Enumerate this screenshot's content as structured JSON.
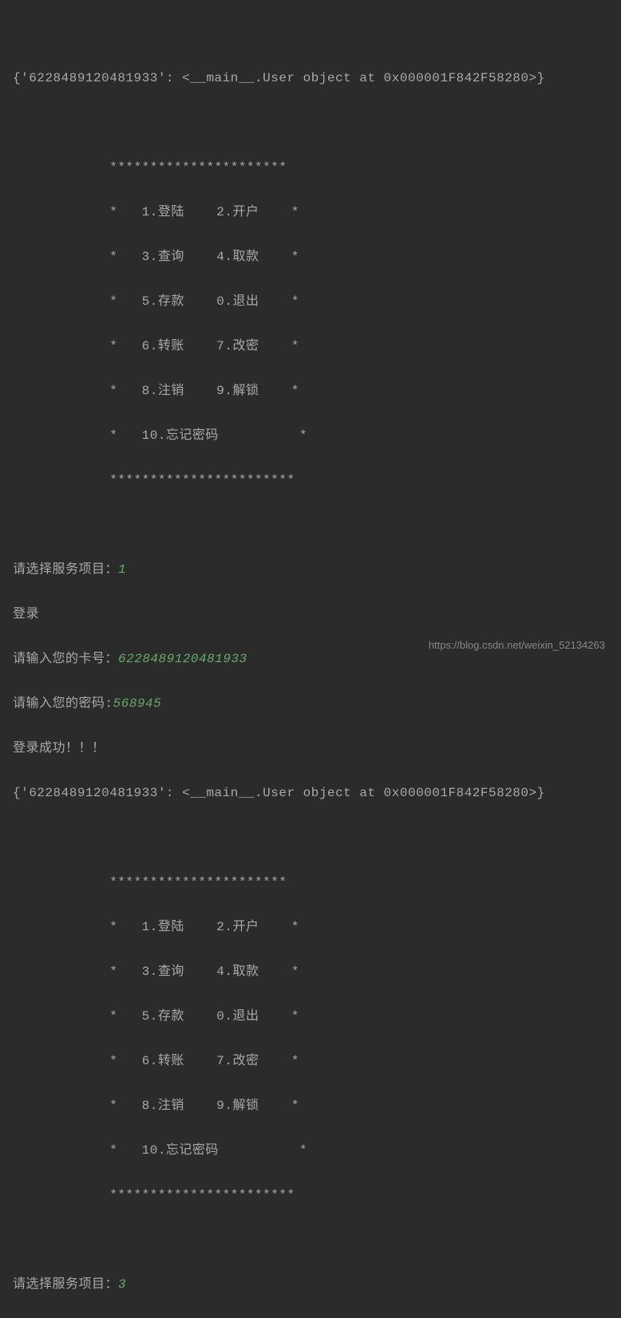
{
  "lines": [
    {
      "indent": "            ",
      "text": ""
    },
    {
      "indent": "",
      "text": "{'6228489120481933': <__main__.User object at 0x000001F842F58280>}"
    },
    {
      "indent": "",
      "text": ""
    },
    {
      "indent": "            ",
      "text": "**********************"
    },
    {
      "indent": "            ",
      "text": "*   1.登陆    2.开户    *"
    },
    {
      "indent": "            ",
      "text": "*   3.查询    4.取款    *"
    },
    {
      "indent": "            ",
      "text": "*   5.存款    0.退出    *"
    },
    {
      "indent": "            ",
      "text": "*   6.转账    7.改密    *"
    },
    {
      "indent": "            ",
      "text": "*   8.注销    9.解锁    *"
    },
    {
      "indent": "            ",
      "text": "*   10.忘记密码          *"
    },
    {
      "indent": "            ",
      "text": "***********************"
    },
    {
      "indent": "",
      "text": ""
    }
  ],
  "prompt1": {
    "label": "请选择服务项目：",
    "input": "1"
  },
  "loginLabel": "登录",
  "prompt2": {
    "label": "请输入您的卡号：",
    "input": "6228489120481933"
  },
  "prompt3": {
    "label": "请输入您的密码:",
    "input": "568945"
  },
  "loginSuccess": "登录成功！！！",
  "dictOutput2": "{'6228489120481933': <__main__.User object at 0x000001F842F58280>}",
  "menu2": [
    {
      "indent": "            ",
      "text": "**********************"
    },
    {
      "indent": "            ",
      "text": "*   1.登陆    2.开户    *"
    },
    {
      "indent": "            ",
      "text": "*   3.查询    4.取款    *"
    },
    {
      "indent": "            ",
      "text": "*   5.存款    0.退出    *"
    },
    {
      "indent": "            ",
      "text": "*   6.转账    7.改密    *"
    },
    {
      "indent": "            ",
      "text": "*   8.注销    9.解锁    *"
    },
    {
      "indent": "            ",
      "text": "*   10.忘记密码          *"
    },
    {
      "indent": "            ",
      "text": "***********************"
    }
  ],
  "prompt4": {
    "label": "请选择服务项目：",
    "input": "3"
  },
  "watermark": "https://blog.csdn.net/weixin_52134263"
}
